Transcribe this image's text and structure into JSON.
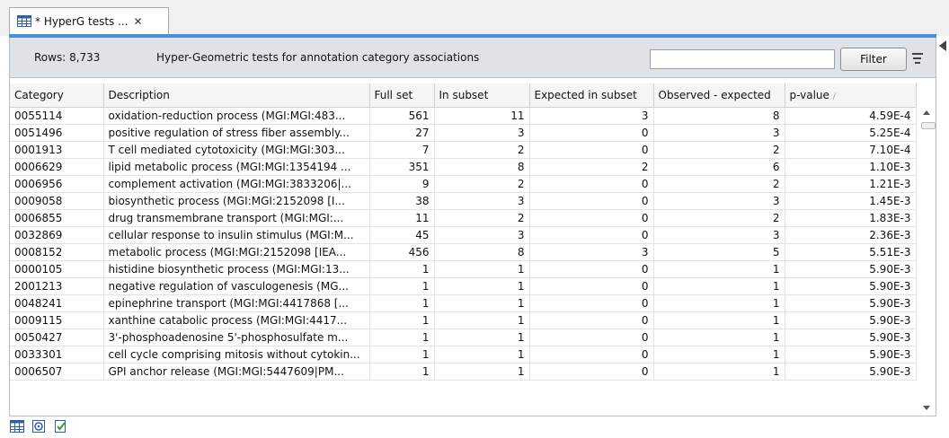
{
  "tab": {
    "title": "* HyperG tests ...",
    "close_glyph": "✕"
  },
  "toolbar": {
    "rows_label": "Rows: 8,733",
    "subtitle": "Hyper-Geometric tests for annotation category associations",
    "filter_value": "",
    "filter_label": "Filter"
  },
  "table": {
    "columns": [
      "Category",
      "Description",
      "Full set",
      "In subset",
      "Expected in subset",
      "Observed - expected",
      "p-value"
    ],
    "sort_column": "p-value",
    "rows": [
      [
        "0055114",
        "oxidation-reduction process (MGI:MGI:483...",
        "561",
        "11",
        "3",
        "8",
        "4.59E-4"
      ],
      [
        "0051496",
        "positive regulation of stress fiber assembly...",
        "27",
        "3",
        "0",
        "3",
        "5.25E-4"
      ],
      [
        "0001913",
        "T cell mediated cytotoxicity (MGI:MGI:303...",
        "7",
        "2",
        "0",
        "2",
        "7.10E-4"
      ],
      [
        "0006629",
        "lipid metabolic process (MGI:MGI:1354194 ...",
        "351",
        "8",
        "2",
        "6",
        "1.10E-3"
      ],
      [
        "0006956",
        "complement activation (MGI:MGI:3833206|...",
        "9",
        "2",
        "0",
        "2",
        "1.21E-3"
      ],
      [
        "0009058",
        "biosynthetic process (MGI:MGI:2152098 [I...",
        "38",
        "3",
        "0",
        "3",
        "1.45E-3"
      ],
      [
        "0006855",
        "drug transmembrane transport (MGI:MGI:...",
        "11",
        "2",
        "0",
        "2",
        "1.83E-3"
      ],
      [
        "0032869",
        "cellular response to insulin stimulus (MGI:M...",
        "45",
        "3",
        "0",
        "3",
        "2.36E-3"
      ],
      [
        "0008152",
        "metabolic process (MGI:MGI:2152098 [IEA...",
        "456",
        "8",
        "3",
        "5",
        "5.51E-3"
      ],
      [
        "0000105",
        "histidine biosynthetic process (MGI:MGI:13...",
        "1",
        "1",
        "0",
        "1",
        "5.90E-3"
      ],
      [
        "2001213",
        "negative regulation of vasculogenesis (MG...",
        "1",
        "1",
        "0",
        "1",
        "5.90E-3"
      ],
      [
        "0048241",
        "epinephrine transport (MGI:MGI:4417868 [...",
        "1",
        "1",
        "0",
        "1",
        "5.90E-3"
      ],
      [
        "0009115",
        "xanthine catabolic process (MGI:MGI:4417...",
        "1",
        "1",
        "0",
        "1",
        "5.90E-3"
      ],
      [
        "0050427",
        "3'-phosphoadenosine 5'-phosphosulfate m...",
        "1",
        "1",
        "0",
        "1",
        "5.90E-3"
      ],
      [
        "0033301",
        "cell cycle comprising mitosis without cytokin...",
        "1",
        "1",
        "0",
        "1",
        "5.90E-3"
      ],
      [
        "0006507",
        "GPI anchor release (MGI:MGI:5447609|PM...",
        "1",
        "1",
        "0",
        "1",
        "5.90E-3"
      ]
    ]
  },
  "icons": {
    "tab": "table-icon",
    "bottom": [
      "table-view-icon",
      "annotation-view-icon",
      "filter-view-icon"
    ]
  },
  "colors": {
    "accent": "#4a90d9",
    "toolbar_bg": "#dfe3e8"
  }
}
